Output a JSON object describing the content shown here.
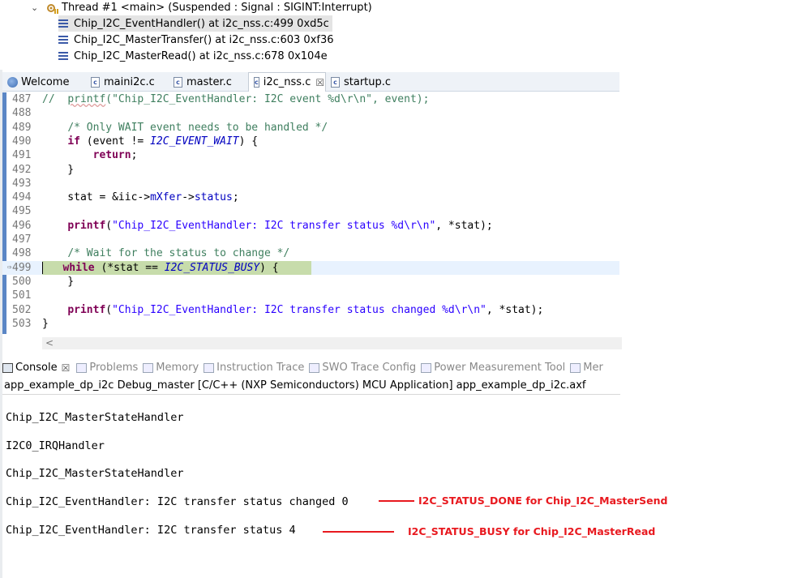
{
  "debug": {
    "thread": "Thread #1 <main> (Suspended : Signal : SIGINT:Interrupt)",
    "frames": [
      "Chip_I2C_EventHandler() at i2c_nss.c:499 0xd5c",
      "Chip_I2C_MasterTransfer() at i2c_nss.c:603 0xf36",
      "Chip_I2C_MasterRead() at i2c_nss.c:678 0x104e"
    ]
  },
  "editor_tabs": [
    "Welcome",
    "maini2c.c",
    "master.c",
    "i2c_nss.c",
    "startup.c"
  ],
  "code": {
    "lines": [
      {
        "n": "487",
        "parts": [
          [
            "cm",
            "//  "
          ],
          [
            "cmsq",
            "printf"
          ],
          [
            "cm",
            "(\"Chip_I2C_EventHandler: I2C event %d\\r\\n\", event);"
          ]
        ]
      },
      {
        "n": "488",
        "parts": []
      },
      {
        "n": "489",
        "parts": [
          [
            "",
            "    "
          ],
          [
            "cm",
            "/* Only WAIT event needs to be handled */"
          ]
        ]
      },
      {
        "n": "490",
        "parts": [
          [
            "",
            "    "
          ],
          [
            "kw",
            "if"
          ],
          [
            "",
            " (event != "
          ],
          [
            "it",
            "I2C_EVENT_WAIT"
          ],
          [
            "",
            ") {"
          ]
        ]
      },
      {
        "n": "491",
        "parts": [
          [
            "",
            "        "
          ],
          [
            "kw",
            "return"
          ],
          [
            "",
            ";"
          ]
        ]
      },
      {
        "n": "492",
        "parts": [
          [
            "",
            "    }"
          ]
        ]
      },
      {
        "n": "493",
        "parts": []
      },
      {
        "n": "494",
        "parts": [
          [
            "",
            "    stat = &iic->"
          ],
          [
            "fld",
            "mXfer"
          ],
          [
            "",
            "->"
          ],
          [
            "fld",
            "status"
          ],
          [
            "",
            ";"
          ]
        ]
      },
      {
        "n": "495",
        "parts": []
      },
      {
        "n": "496",
        "parts": [
          [
            "",
            "    "
          ],
          [
            "kw",
            "printf"
          ],
          [
            "",
            "("
          ],
          [
            "st",
            "\"Chip_I2C_EventHandler: I2C transfer status %d\\r\\n\""
          ],
          [
            "",
            ", *stat);"
          ]
        ]
      },
      {
        "n": "497",
        "parts": []
      },
      {
        "n": "498",
        "parts": [
          [
            "",
            "    "
          ],
          [
            "cm",
            "/* Wait for the status to change */"
          ]
        ]
      },
      {
        "n": "499",
        "parts": [
          [
            "",
            "    "
          ],
          [
            "kw",
            "while"
          ],
          [
            "",
            " (*stat == "
          ],
          [
            "it",
            "I2C_STATUS_BUSY"
          ],
          [
            "",
            ") {"
          ]
        ]
      },
      {
        "n": "500",
        "parts": [
          [
            "",
            "    }"
          ]
        ]
      },
      {
        "n": "501",
        "parts": []
      },
      {
        "n": "502",
        "parts": [
          [
            "",
            "    "
          ],
          [
            "kw",
            "printf"
          ],
          [
            "",
            "("
          ],
          [
            "st",
            "\"Chip_I2C_EventHandler: I2C transfer status changed %d\\r\\n\""
          ],
          [
            "",
            ", *stat);"
          ]
        ]
      },
      {
        "n": "503",
        "parts": [
          [
            "",
            "}"
          ]
        ]
      }
    ]
  },
  "console_tabs": [
    "Console",
    "Problems",
    "Memory",
    "Instruction Trace",
    "SWO Trace Config",
    "Power Measurement Tool",
    "Mer"
  ],
  "console": {
    "title": "app_example_dp_i2c Debug_master [C/C++ (NXP Semiconductors) MCU Application] app_example_dp_i2c.axf",
    "lines": [
      "Chip_I2C_MasterStateHandler",
      "I2C0_IRQHandler",
      "Chip_I2C_MasterStateHandler",
      "Chip_I2C_EventHandler: I2C transfer status changed 0",
      "Chip_I2C_EventHandler: I2C transfer status 4"
    ]
  },
  "annotations": [
    "I2C_STATUS_DONE for Chip_I2C_MasterSend",
    "I2C_STATUS_BUSY for Chip_I2C_MasterRead"
  ],
  "colors": {
    "annotation": "#e8191f",
    "keyword": "#7f0055",
    "comment": "#3f7f5f",
    "string": "#2a00ff",
    "constant": "#0000c0",
    "current_line": "#c7dcab"
  }
}
